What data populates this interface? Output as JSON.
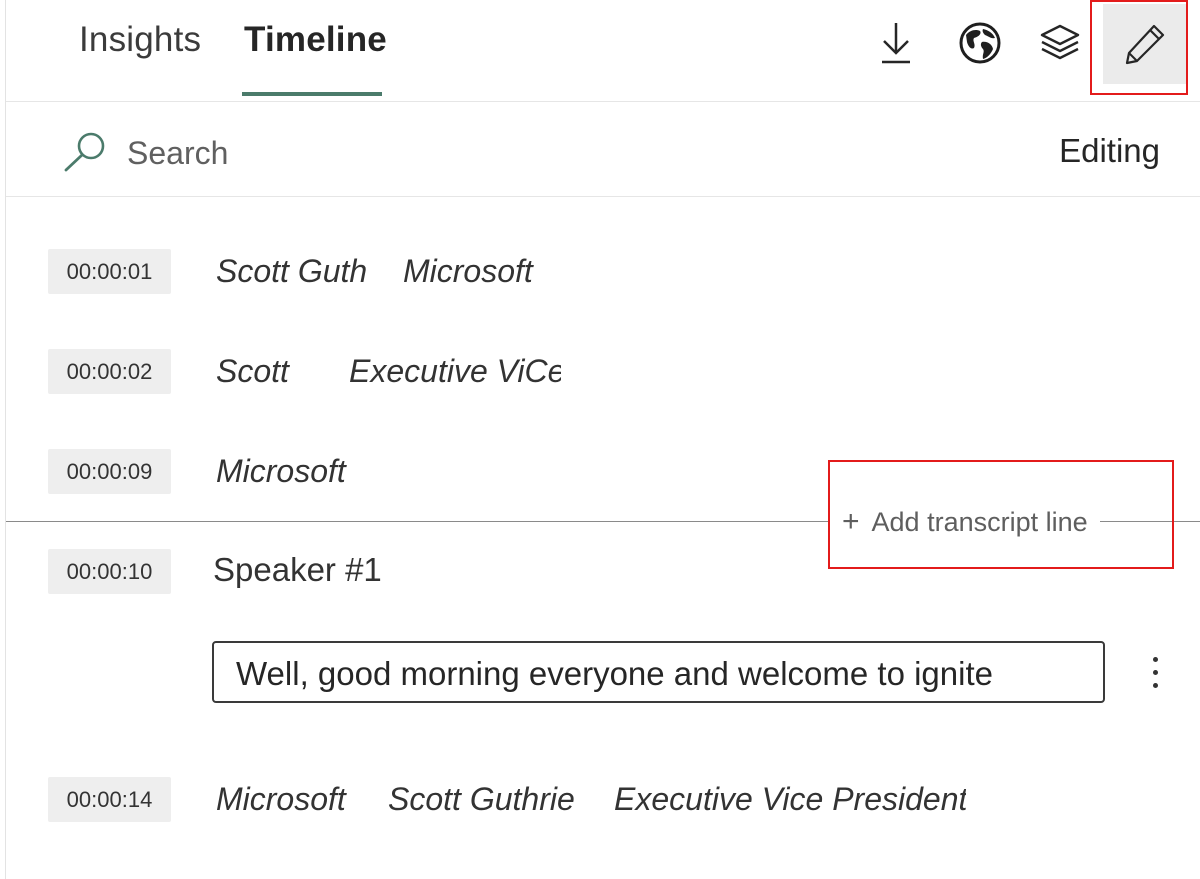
{
  "tabs": [
    {
      "label": "Insights",
      "active": false
    },
    {
      "label": "Timeline",
      "active": true
    }
  ],
  "toolbar": {
    "icons": [
      "download-icon",
      "globe-icon",
      "layers-icon",
      "pencil-icon"
    ],
    "active_tool": "pencil-icon"
  },
  "search": {
    "placeholder": "Search",
    "value": ""
  },
  "mode_label": "Editing",
  "rows": [
    {
      "time": "00:00:01",
      "tags": [
        "Scott Guth",
        "Microsoft"
      ]
    },
    {
      "time": "00:00:02",
      "tags": [
        "Scott",
        "Executive ViCe"
      ]
    },
    {
      "time": "00:00:09",
      "tags": [
        "Microsoft"
      ]
    },
    {
      "time": "00:00:10",
      "speaker": "Speaker #1",
      "text": "Well, good morning everyone and welcome to ignite"
    },
    {
      "time": "00:00:14",
      "tags": [
        "Microsoft",
        "Scott Guthrie",
        "Executive Vice President"
      ]
    }
  ],
  "add_line_label": "Add transcript line",
  "colors": {
    "accent": "#4b7b6b",
    "highlight": "#e31b1b"
  }
}
